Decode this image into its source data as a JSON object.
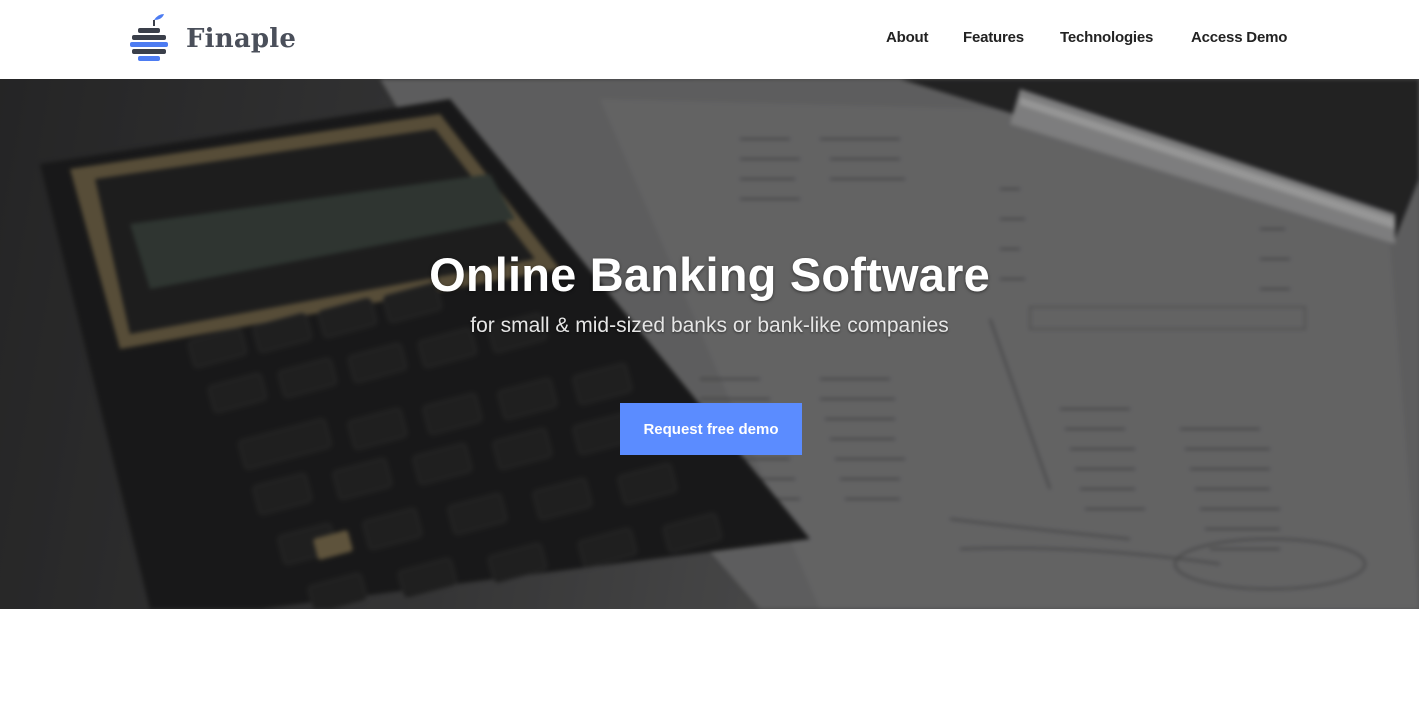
{
  "brand": {
    "name": "Finaple",
    "logo_icon": "stacked-coins-icon",
    "colors": {
      "logo_blue": "#4d7cf2",
      "logo_dark": "#3a3f4a"
    }
  },
  "nav": {
    "items": [
      {
        "label": "About"
      },
      {
        "label": "Features"
      },
      {
        "label": "Technologies"
      },
      {
        "label": "Access Demo"
      }
    ]
  },
  "hero": {
    "title": "Online Banking Software",
    "subtitle": "for small & mid-sized banks or bank-like companies",
    "cta_label": "Request free demo",
    "cta_color": "#5b8cff",
    "background_image": "calculator-and-pen-on-financial-papers"
  }
}
